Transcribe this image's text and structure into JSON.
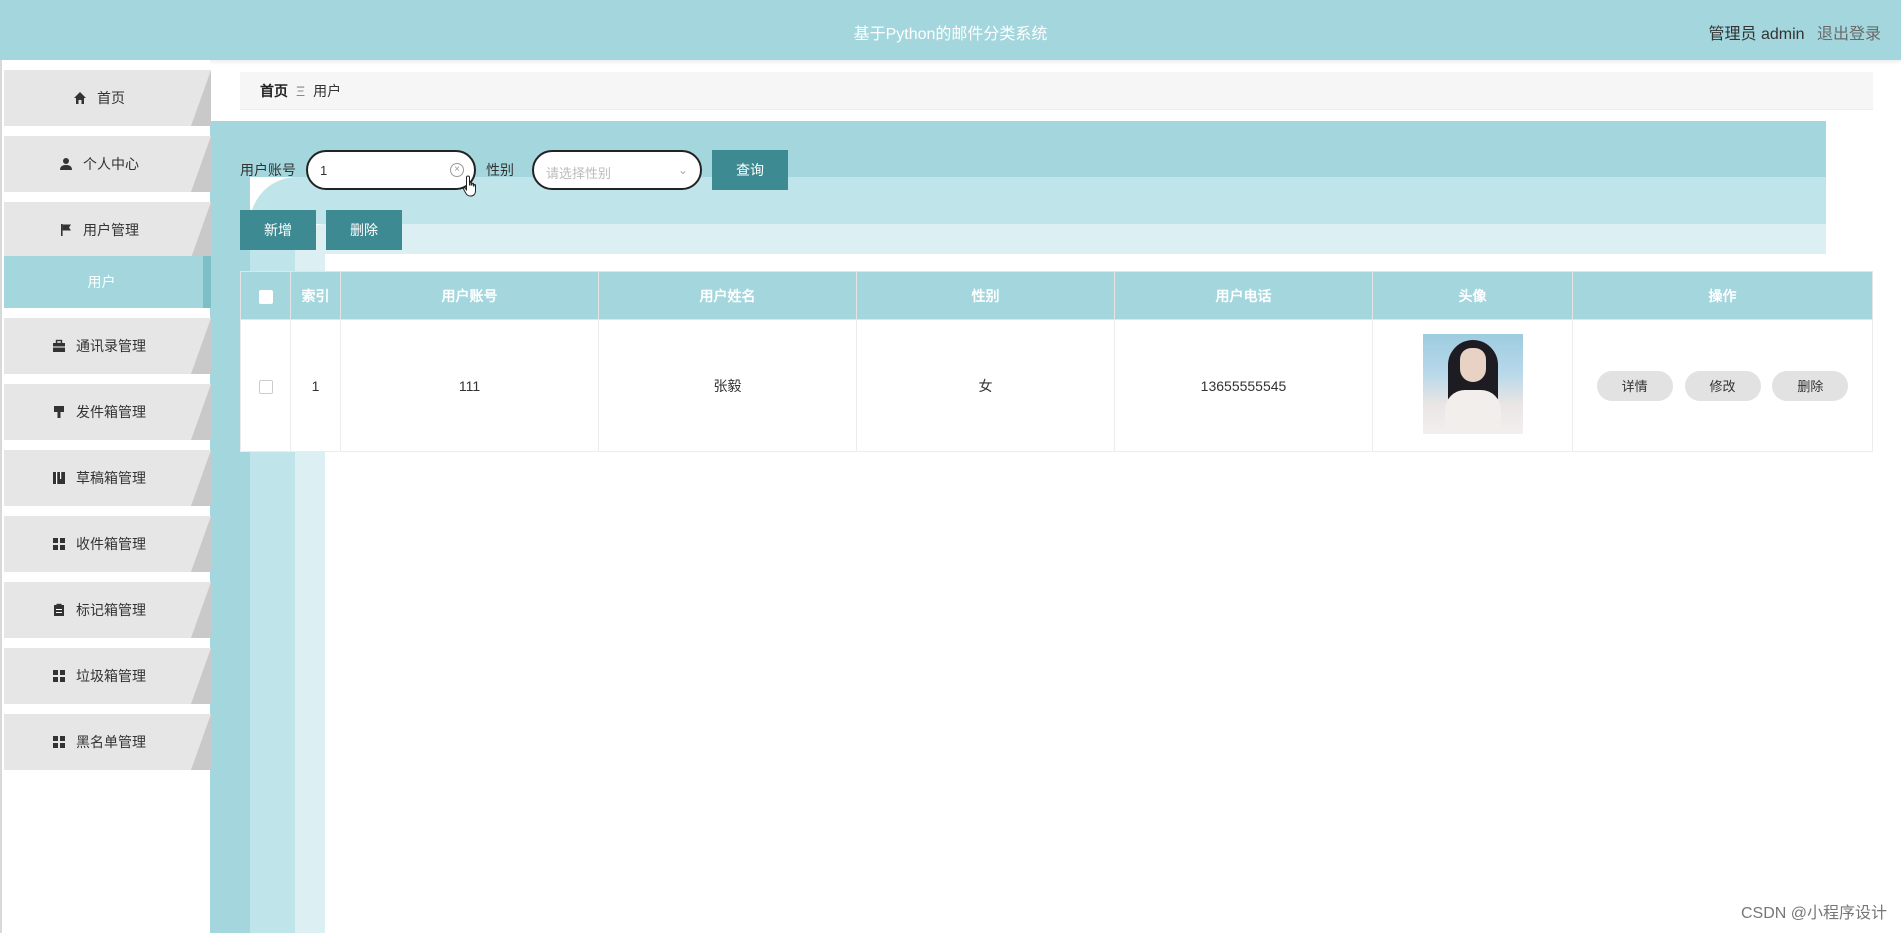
{
  "header": {
    "title": "基于Python的邮件分类系统",
    "user_label": "管理员 admin",
    "logout": "退出登录"
  },
  "sidebar": {
    "items": [
      {
        "label": "首页",
        "icon": "home-icon"
      },
      {
        "label": "个人中心",
        "icon": "user-icon"
      },
      {
        "label": "用户管理",
        "icon": "flag-icon"
      },
      {
        "label": "用户",
        "icon": ""
      },
      {
        "label": "通讯录管理",
        "icon": "briefcase-icon"
      },
      {
        "label": "发件箱管理",
        "icon": "brush-icon"
      },
      {
        "label": "草稿箱管理",
        "icon": "book-icon"
      },
      {
        "label": "收件箱管理",
        "icon": "grid-icon"
      },
      {
        "label": "标记箱管理",
        "icon": "clipboard-icon"
      },
      {
        "label": "垃圾箱管理",
        "icon": "grid-icon"
      },
      {
        "label": "黑名单管理",
        "icon": "grid-icon"
      }
    ]
  },
  "breadcrumb": {
    "home": "首页",
    "separator": "Ξ",
    "current": "用户"
  },
  "search": {
    "account_label": "用户账号",
    "account_value": "1",
    "gender_label": "性别",
    "gender_placeholder": "请选择性别",
    "query_button": "查询"
  },
  "actions": {
    "add": "新增",
    "delete": "删除"
  },
  "table": {
    "headers": [
      "",
      "索引",
      "用户账号",
      "用户姓名",
      "性别",
      "用户电话",
      "头像",
      "操作"
    ],
    "rows": [
      {
        "index": "1",
        "account": "111",
        "name": "张毅",
        "gender": "女",
        "phone": "13655555545"
      }
    ],
    "row_buttons": {
      "detail": "详情",
      "edit": "修改",
      "delete": "删除"
    }
  },
  "watermark": "CSDN @小程序设计",
  "colors": {
    "header_bg": "#a3d6dd",
    "button_bg": "#3e8a92",
    "menu_bg": "#e6e6e6"
  }
}
